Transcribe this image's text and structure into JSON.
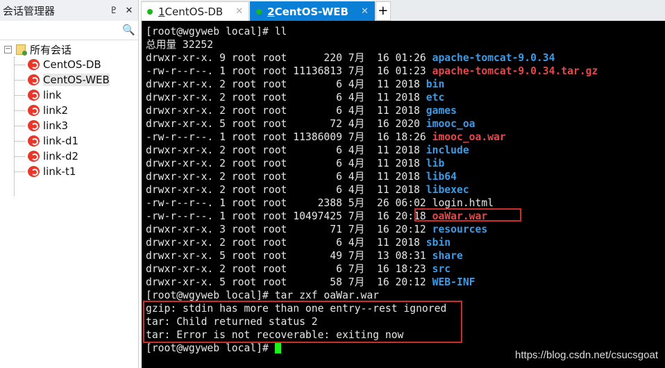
{
  "sidebar": {
    "title": "会话管理器",
    "pin": "♇",
    "close": "✕",
    "search_placeholder": "",
    "root": "所有会话",
    "sessions": [
      "CentOS-DB",
      "CentOS-WEB",
      "link",
      "link2",
      "link3",
      "link-d1",
      "link-d2",
      "link-t1"
    ],
    "selected": "CentOS-WEB"
  },
  "tabs": [
    {
      "num": "1",
      "label": " CentOS-DB",
      "active": false
    },
    {
      "num": "2",
      "label": " CentOS-WEB",
      "active": true
    }
  ],
  "terminal": {
    "prompt1": "[root@wgyweb local]# ll",
    "total": "总用量 32252",
    "entries": [
      {
        "prefix": "drwxr-xr-x. 9 root root      220 7月  16 01:26 ",
        "name": "apache-tomcat-9.0.34",
        "type": "dir"
      },
      {
        "prefix": "-rw-r--r--. 1 root root 11136813 7月  16 01:23 ",
        "name": "apache-tomcat-9.0.34.tar.gz",
        "type": "arc"
      },
      {
        "prefix": "drwxr-xr-x. 2 root root        6 4月  11 2018 ",
        "name": "bin",
        "type": "dir"
      },
      {
        "prefix": "drwxr-xr-x. 2 root root        6 4月  11 2018 ",
        "name": "etc",
        "type": "dir"
      },
      {
        "prefix": "drwxr-xr-x. 2 root root        6 4月  11 2018 ",
        "name": "games",
        "type": "dir"
      },
      {
        "prefix": "drwxr-xr-x. 5 root root       72 4月  16 2020 ",
        "name": "imooc_oa",
        "type": "dir"
      },
      {
        "prefix": "-rw-r--r--. 1 root root 11386009 7月  16 18:26 ",
        "name": "imooc_oa.war",
        "type": "arc"
      },
      {
        "prefix": "drwxr-xr-x. 2 root root        6 4月  11 2018 ",
        "name": "include",
        "type": "dir"
      },
      {
        "prefix": "drwxr-xr-x. 2 root root        6 4月  11 2018 ",
        "name": "lib",
        "type": "dir"
      },
      {
        "prefix": "drwxr-xr-x. 2 root root        6 4月  11 2018 ",
        "name": "lib64",
        "type": "dir"
      },
      {
        "prefix": "drwxr-xr-x. 2 root root        6 4月  11 2018 ",
        "name": "libexec",
        "type": "dir"
      },
      {
        "prefix": "-rw-r--r--. 1 root root     2388 5月  26 06:02 ",
        "name": "login.html",
        "type": "file"
      },
      {
        "prefix": "-rw-r--r--. 1 root root 10497425 7月  16 20:18 ",
        "name": "oaWar.war",
        "type": "arc"
      },
      {
        "prefix": "drwxr-xr-x. 3 root root       71 7月  16 20:12 ",
        "name": "resources",
        "type": "dir"
      },
      {
        "prefix": "drwxr-xr-x. 2 root root        6 4月  11 2018 ",
        "name": "sbin",
        "type": "dir"
      },
      {
        "prefix": "drwxr-xr-x. 5 root root       49 7月  13 08:31 ",
        "name": "share",
        "type": "dir"
      },
      {
        "prefix": "drwxr-xr-x. 2 root root        6 7月  16 18:23 ",
        "name": "src",
        "type": "dir"
      },
      {
        "prefix": "drwxr-xr-x. 5 root root       58 7月  16 20:12 ",
        "name": "WEB-INF",
        "type": "dir"
      }
    ],
    "prompt2": "[root@wgyweb local]# tar zxf oaWar.war",
    "errors": [
      "gzip: stdin has more than one entry--rest ignored",
      "tar: Child returned status 2",
      "tar: Error is not recoverable: exiting now"
    ],
    "prompt3": "[root@wgyweb local]# "
  },
  "watermark": "https://blog.csdn.net/csucsgoat"
}
